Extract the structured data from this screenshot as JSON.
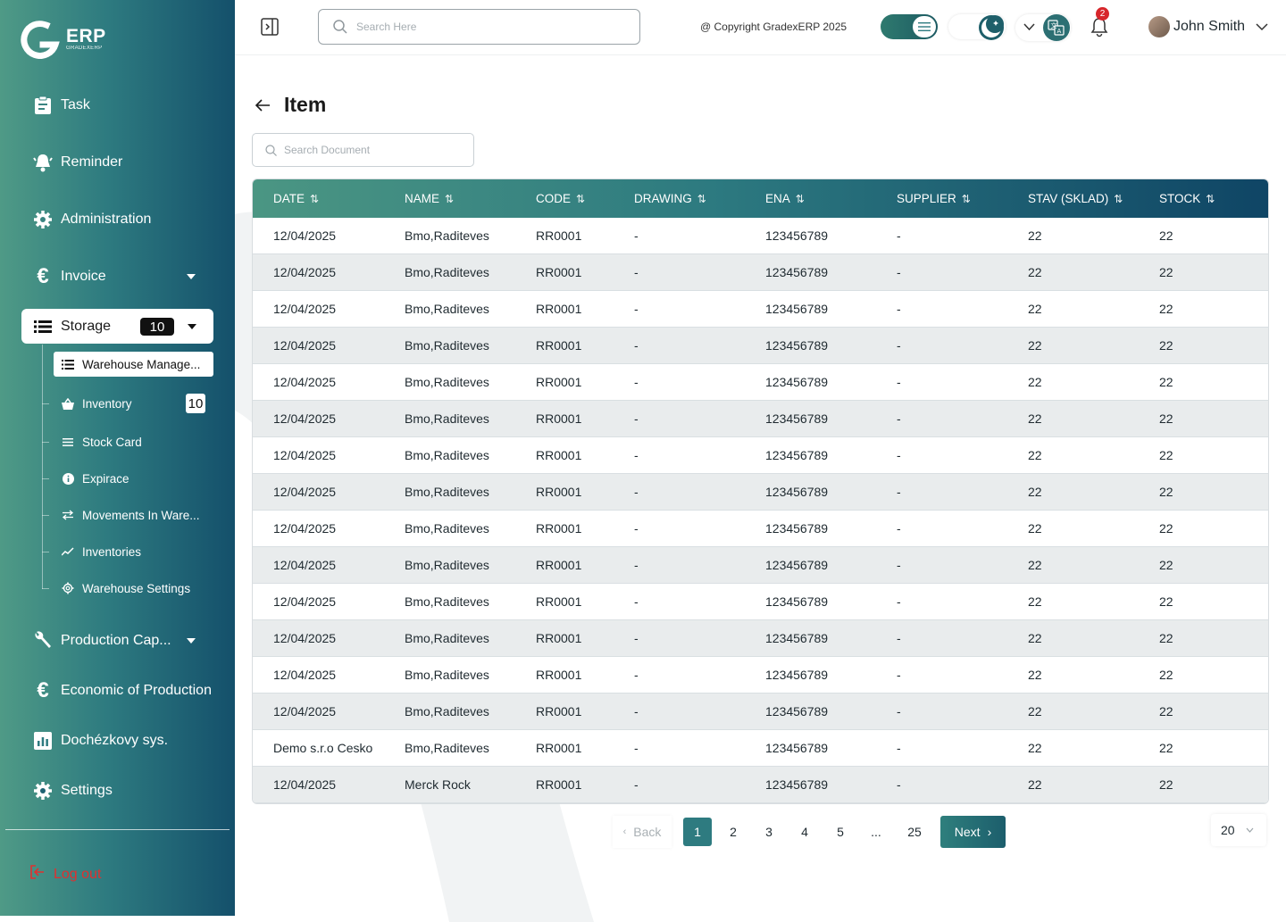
{
  "brand": {
    "name": "ERP",
    "sub": "GRADEXERP"
  },
  "sidebar": {
    "items": [
      {
        "label": "Task",
        "icon": "clipboard-icon"
      },
      {
        "label": "Reminder",
        "icon": "bell-alert-icon"
      },
      {
        "label": "Administration",
        "icon": "gear-icon"
      },
      {
        "label": "Invoice",
        "icon": "euro-icon"
      },
      {
        "label": "Storage",
        "icon": "list-icon",
        "badge": "10"
      },
      {
        "label": "Production Cap...",
        "icon": "wrench-icon"
      },
      {
        "label": "Economic of Production",
        "icon": "euro-icon"
      },
      {
        "label": "Dochézkovy sys.",
        "icon": "chart-icon"
      },
      {
        "label": "Settings",
        "icon": "gear-icon"
      }
    ],
    "storage_sub": [
      {
        "label": "Warehouse Manage...",
        "icon": "list-icon"
      },
      {
        "label": "Inventory",
        "icon": "basket-icon",
        "badge": "10"
      },
      {
        "label": "Stock Card",
        "icon": "lines-icon"
      },
      {
        "label": "Expirace",
        "icon": "info-icon"
      },
      {
        "label": "Movements In Ware...",
        "icon": "swap-icon"
      },
      {
        "label": "Inventories",
        "icon": "trend-icon"
      },
      {
        "label": "Warehouse Settings",
        "icon": "gear-icon"
      }
    ],
    "logout": "Log out"
  },
  "header": {
    "search_placeholder": "Search Here",
    "copyright": "@ Copyright GradexERP 2025",
    "notifications": "2",
    "user_name": "John Smith"
  },
  "page": {
    "title": "Item",
    "search_placeholder": "Search Document"
  },
  "table": {
    "columns": [
      "DATE",
      "NAME",
      "CODE",
      "DRAWING",
      "ENA",
      "SUPPLIER",
      "STAV (SKLAD)",
      "STOCK"
    ],
    "rows": [
      [
        "12/04/2025",
        "Bmo,Raditeves",
        "RR0001",
        "-",
        "123456789",
        "-",
        "22",
        "22"
      ],
      [
        "12/04/2025",
        "Bmo,Raditeves",
        "RR0001",
        "-",
        "123456789",
        "-",
        "22",
        "22"
      ],
      [
        "12/04/2025",
        "Bmo,Raditeves",
        "RR0001",
        "-",
        "123456789",
        "-",
        "22",
        "22"
      ],
      [
        "12/04/2025",
        "Bmo,Raditeves",
        "RR0001",
        "-",
        "123456789",
        "-",
        "22",
        "22"
      ],
      [
        "12/04/2025",
        "Bmo,Raditeves",
        "RR0001",
        "-",
        "123456789",
        "-",
        "22",
        "22"
      ],
      [
        "12/04/2025",
        "Bmo,Raditeves",
        "RR0001",
        "-",
        "123456789",
        "-",
        "22",
        "22"
      ],
      [
        "12/04/2025",
        "Bmo,Raditeves",
        "RR0001",
        "-",
        "123456789",
        "-",
        "22",
        "22"
      ],
      [
        "12/04/2025",
        "Bmo,Raditeves",
        "RR0001",
        "-",
        "123456789",
        "-",
        "22",
        "22"
      ],
      [
        "12/04/2025",
        "Bmo,Raditeves",
        "RR0001",
        "-",
        "123456789",
        "-",
        "22",
        "22"
      ],
      [
        "12/04/2025",
        "Bmo,Raditeves",
        "RR0001",
        "-",
        "123456789",
        "-",
        "22",
        "22"
      ],
      [
        "12/04/2025",
        "Bmo,Raditeves",
        "RR0001",
        "-",
        "123456789",
        "-",
        "22",
        "22"
      ],
      [
        "12/04/2025",
        "Bmo,Raditeves",
        "RR0001",
        "-",
        "123456789",
        "-",
        "22",
        "22"
      ],
      [
        "12/04/2025",
        "Bmo,Raditeves",
        "RR0001",
        "-",
        "123456789",
        "-",
        "22",
        "22"
      ],
      [
        "12/04/2025",
        "Bmo,Raditeves",
        "RR0001",
        "-",
        "123456789",
        "-",
        "22",
        "22"
      ],
      [
        "Demo s.r.o Cesko",
        "Bmo,Raditeves",
        "RR0001",
        "-",
        "123456789",
        "-",
        "22",
        "22"
      ],
      [
        "12/04/2025",
        "Merck Rock",
        "RR0001",
        "-",
        "123456789",
        "-",
        "22",
        "22"
      ]
    ]
  },
  "pagination": {
    "back": "Back",
    "pages": [
      "1",
      "2",
      "3",
      "4",
      "5",
      "...",
      "25"
    ],
    "current": "1",
    "next": "Next",
    "per_page": "20"
  },
  "colors": {
    "accent": "#2e7b80",
    "danger": "#e0302f",
    "row_alt": "#e9eced"
  }
}
